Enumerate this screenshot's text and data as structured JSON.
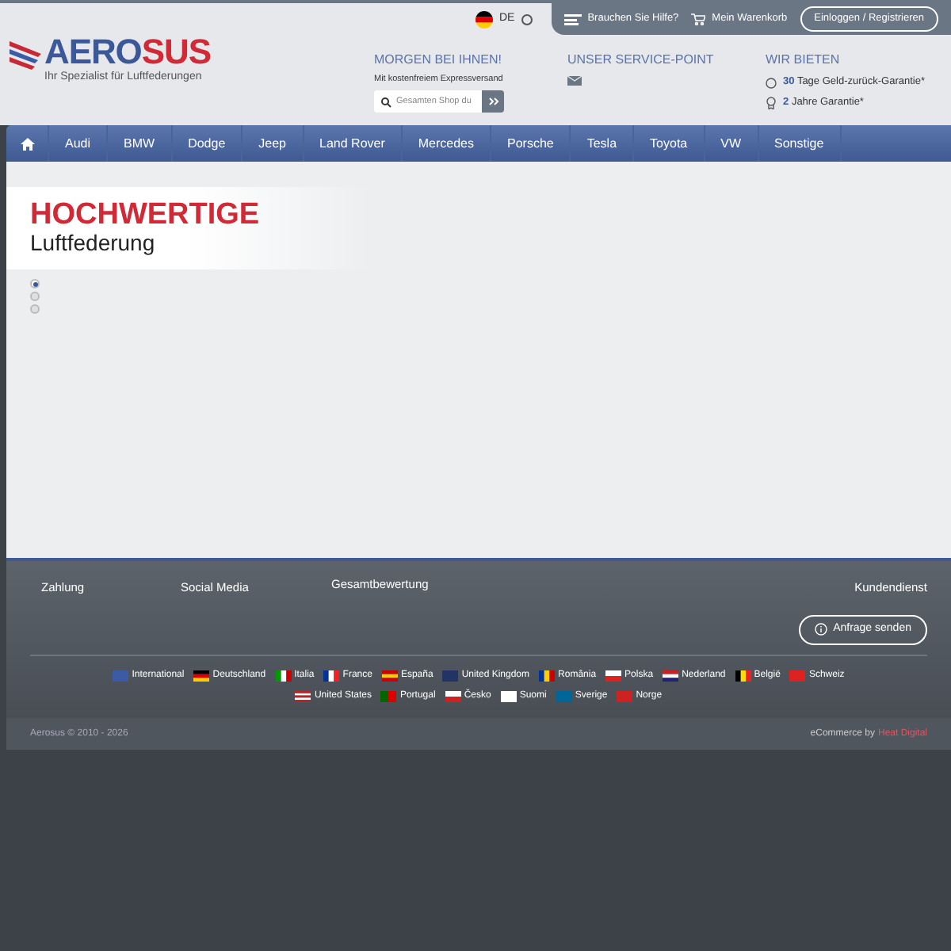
{
  "top_bar": {
    "language": "DE",
    "help": "Brauchen Sie Hilfe?",
    "cart": "Mein Warenkorb",
    "login": "Einloggen / Registrieren"
  },
  "logo": {
    "part_1": "AERO",
    "part_2": "SUS",
    "tagline": "Ihr Spezialist für Luftfederungen"
  },
  "delivery": {
    "title": "MORGEN BEI IHNEN!",
    "subtitle": "Mit kostenfreiem Expressversand",
    "search": {
      "placeholder": "Gesamten Shop du"
    }
  },
  "service": {
    "title": "UNSER SERVICE-POINT"
  },
  "offers": {
    "title": "WIR BIETEN",
    "items": [
      {
        "strong": "30",
        "text": "Tage Geld-zurück-Garantie*"
      },
      {
        "strong": "2",
        "text": "Jahre Garantie*"
      }
    ]
  },
  "nav": {
    "items": [
      "Audi",
      "BMW",
      "Dodge",
      "Jeep",
      "Land Rover",
      "Mercedes",
      "Porsche",
      "Tesla",
      "Toyota",
      "VW",
      "Sonstige"
    ]
  },
  "hero": {
    "title": "HOCHWERTIGE",
    "subtitle": "Luftfederung",
    "dots": [
      {
        "selected": true
      },
      {
        "selected": false
      },
      {
        "selected": false
      }
    ]
  },
  "footer": {
    "columns": [
      "Zahlung",
      "Social Media",
      "Gesamtbewertung",
      "Kundendienst"
    ],
    "inquiry": "Anfrage senden",
    "countries": [
      [
        "International",
        "Deutschland",
        "Italia",
        "France",
        "España",
        "United Kingdom",
        "România",
        "Polska",
        "Nederland",
        "België",
        "Schweiz"
      ],
      [
        "United States",
        "Portugal",
        "Česko",
        "Suomi",
        "Sverige",
        "Norge"
      ]
    ],
    "copyright": "Aerosus © 2010 - 2026",
    "credit": "eCommerce by",
    "credit_link": "Heat Digital"
  }
}
